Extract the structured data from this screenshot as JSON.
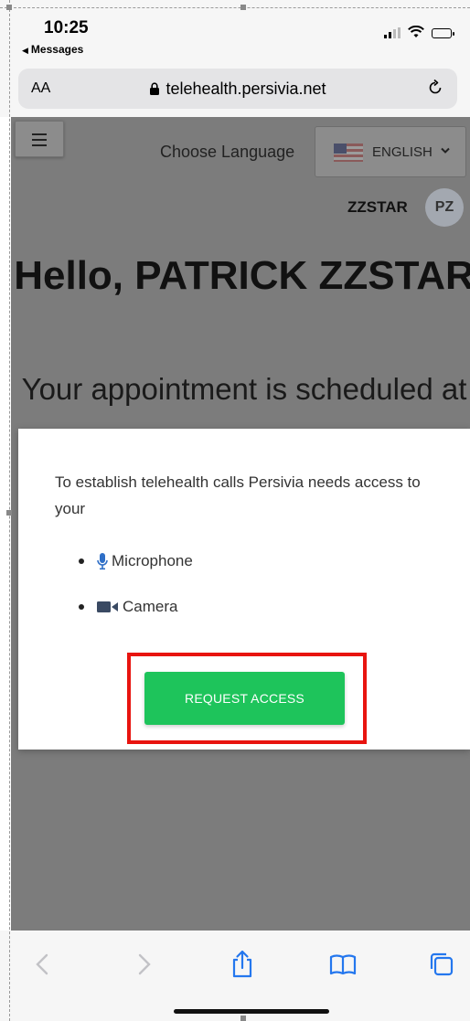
{
  "status_bar": {
    "time": "10:25",
    "back_app": "Messages",
    "icons": [
      "signal-icon",
      "wifi-icon",
      "battery-icon"
    ]
  },
  "browser": {
    "text_size": "AA",
    "url": "telehealth.persivia.net",
    "icons": [
      "lock-icon",
      "reload-icon"
    ]
  },
  "header": {
    "menu_icon": "hamburger-icon",
    "language_label": "Choose Language",
    "language_value": "ENGLISH",
    "flag_icon": "us-flag-icon"
  },
  "user": {
    "name": "ZZSTAR",
    "initials": "PZ"
  },
  "main": {
    "greeting": "Hello, PATRICK ZZSTAR",
    "appointment_text": "Your appointment is scheduled at"
  },
  "modal": {
    "message": "To establish telehealth calls Persivia needs access to your",
    "permissions": [
      {
        "label": "Microphone",
        "icon": "microphone-icon"
      },
      {
        "label": "Camera",
        "icon": "camera-icon"
      }
    ],
    "button_label": "REQUEST ACCESS",
    "button_color": "#1ec45b",
    "highlight_color": "#e8140f"
  },
  "toolbar": {
    "icons": [
      "back-icon",
      "forward-icon",
      "share-icon",
      "bookmarks-icon",
      "tabs-icon"
    ]
  }
}
